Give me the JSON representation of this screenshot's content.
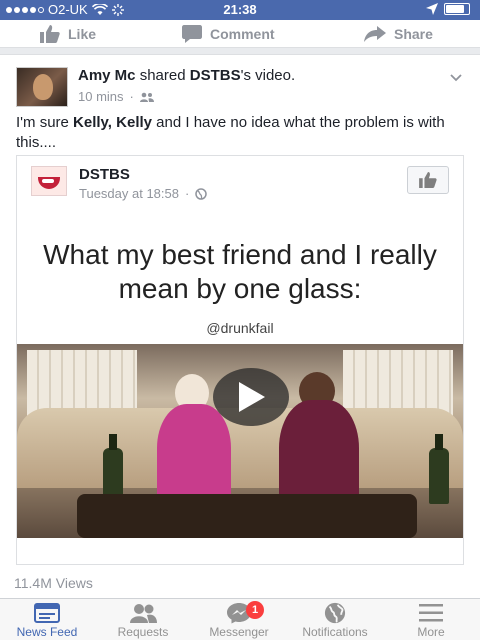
{
  "status_bar": {
    "carrier": "O2-UK",
    "time": "21:38",
    "battery_level": 0.85
  },
  "actions": {
    "like": "Like",
    "comment": "Comment",
    "share": "Share"
  },
  "post": {
    "author": "Amy Mc",
    "verb": "shared",
    "page": "DSTBS",
    "suffix": "'s video.",
    "time": "10 mins",
    "text_prefix": "I'm sure ",
    "mention1": "Kelly",
    "sep": ", ",
    "mention2": "Kelly",
    "text_suffix": " and I have no idea what the problem is with this...."
  },
  "shared": {
    "page_name": "DSTBS",
    "time": "Tuesday at 18:58",
    "caption": "What my best friend and I really mean by one glass:",
    "handle": "@drunkfail",
    "views": "11.4M Views"
  },
  "tabs": [
    {
      "label": "News Feed",
      "icon": "news-feed-icon"
    },
    {
      "label": "Requests",
      "icon": "friends-icon"
    },
    {
      "label": "Messenger",
      "icon": "messenger-icon",
      "badge": "1"
    },
    {
      "label": "Notifications",
      "icon": "globe-icon"
    },
    {
      "label": "More",
      "icon": "menu-icon"
    }
  ],
  "colors": {
    "brand": "#4267b2",
    "badge": "#fa3e3e"
  }
}
